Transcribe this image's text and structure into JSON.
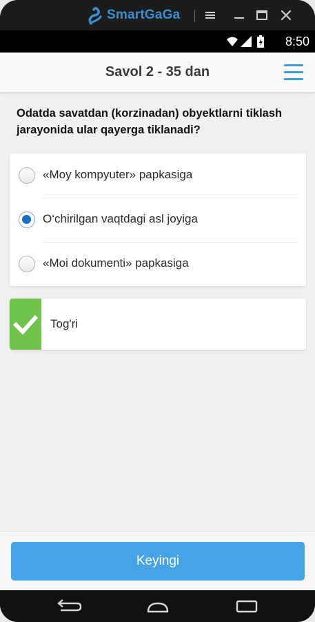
{
  "emulator": {
    "title": "SmartGaGa",
    "brand_color": "#3a8fd9",
    "controls": [
      "menu-icon",
      "minimize-icon",
      "maximize-icon",
      "close-icon"
    ]
  },
  "status_bar": {
    "time": "8:50",
    "icons": [
      "wifi-icon",
      "signal-icon",
      "battery-icon"
    ]
  },
  "header": {
    "title": "Savol 2 - 35 dan",
    "menu_icon": "hamburger-icon",
    "accent": "#3a9be0"
  },
  "question": {
    "text": "Odatda savatdan (korzinadan) obyektlarni tiklash jarayonida ular qayerga tiklanadi?"
  },
  "options": [
    {
      "label": "«Moy kompyuter» papkasiga",
      "selected": false
    },
    {
      "label": "O‘chirilgan vaqtdagi asl joyiga",
      "selected": true
    },
    {
      "label": "«Moi dokumenti» papkasiga",
      "selected": false
    }
  ],
  "result": {
    "text": "Tog'ri",
    "icon": "checkmark-icon",
    "color": "#6fc24a"
  },
  "footer": {
    "next_label": "Keyingi",
    "button_color": "#46a3e5"
  },
  "nav_bar": {
    "icons": [
      "back-icon",
      "home-icon",
      "recent-apps-icon"
    ]
  }
}
